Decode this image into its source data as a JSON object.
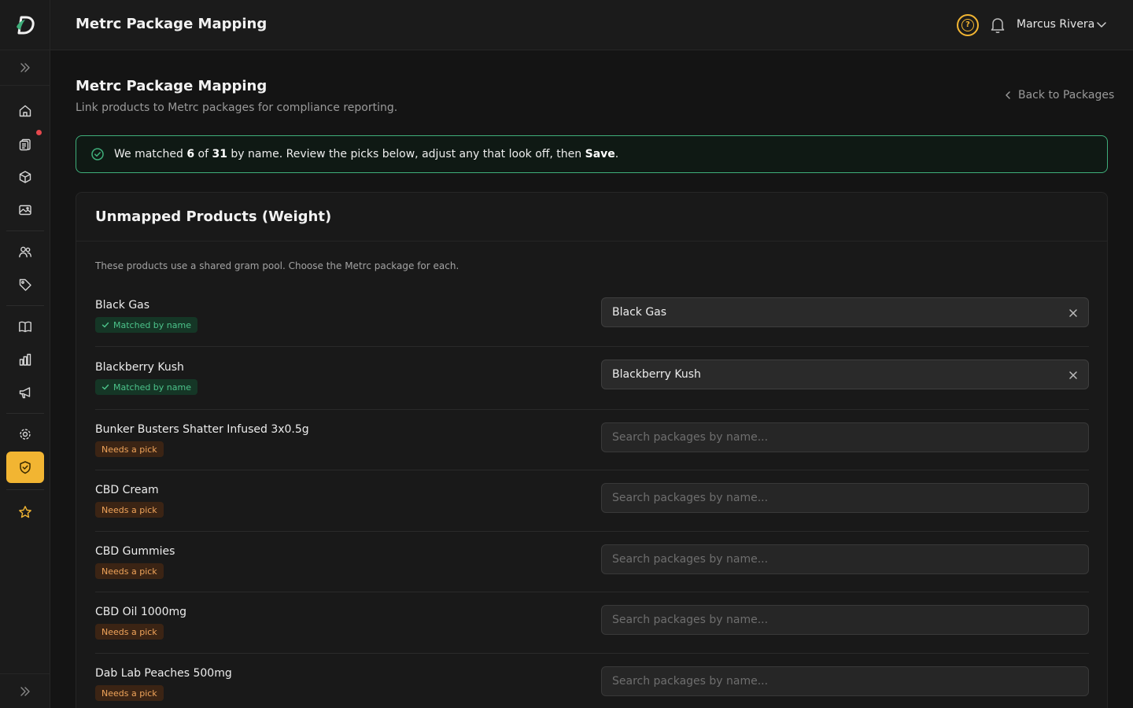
{
  "app": {
    "title": "Metrc Package Mapping",
    "user_name": "Marcus Rivera",
    "help_glyph": "?"
  },
  "colors": {
    "accent": "#f2b532",
    "success": "#4cc38a",
    "warning": "#f0a45a",
    "notification": "#e5484d"
  },
  "sidebar": {
    "items": [
      {
        "name": "home-icon"
      },
      {
        "name": "clipboard-icon"
      },
      {
        "name": "box-icon"
      },
      {
        "name": "image-icon"
      },
      {
        "name": "users-icon"
      },
      {
        "name": "tag-icon"
      },
      {
        "name": "book-icon"
      },
      {
        "name": "bar-chart-icon"
      },
      {
        "name": "megaphone-icon"
      },
      {
        "name": "gear-icon"
      },
      {
        "name": "shield-check-icon"
      },
      {
        "name": "star-icon"
      }
    ]
  },
  "page": {
    "title": "Metrc Package Mapping",
    "subtitle": "Link products to Metrc packages for compliance reporting.",
    "back_label": "Back to Packages"
  },
  "banner": {
    "prefix": "We matched ",
    "matched": "6",
    "of": " of ",
    "total": "31",
    "middle": " by name. Review the picks below, adjust any that look off, then ",
    "save_word": "Save",
    "suffix": "."
  },
  "card": {
    "title": "Unmapped Products (Weight)",
    "description": "These products use a shared gram pool. Choose the Metrc package for each.",
    "search_placeholder": "Search packages by name...",
    "rows": [
      {
        "product": "Black Gas",
        "status": "Matched by name",
        "matched": true,
        "package": "Black Gas"
      },
      {
        "product": "Blackberry Kush",
        "status": "Matched by name",
        "matched": true,
        "package": "Blackberry Kush"
      },
      {
        "product": "Bunker Busters Shatter Infused 3x0.5g",
        "status": "Needs a pick",
        "matched": false,
        "package": ""
      },
      {
        "product": "CBD Cream",
        "status": "Needs a pick",
        "matched": false,
        "package": ""
      },
      {
        "product": "CBD Gummies",
        "status": "Needs a pick",
        "matched": false,
        "package": ""
      },
      {
        "product": "CBD Oil 1000mg",
        "status": "Needs a pick",
        "matched": false,
        "package": ""
      },
      {
        "product": "Dab Lab Peaches 500mg",
        "status": "Needs a pick",
        "matched": false,
        "package": ""
      }
    ]
  }
}
